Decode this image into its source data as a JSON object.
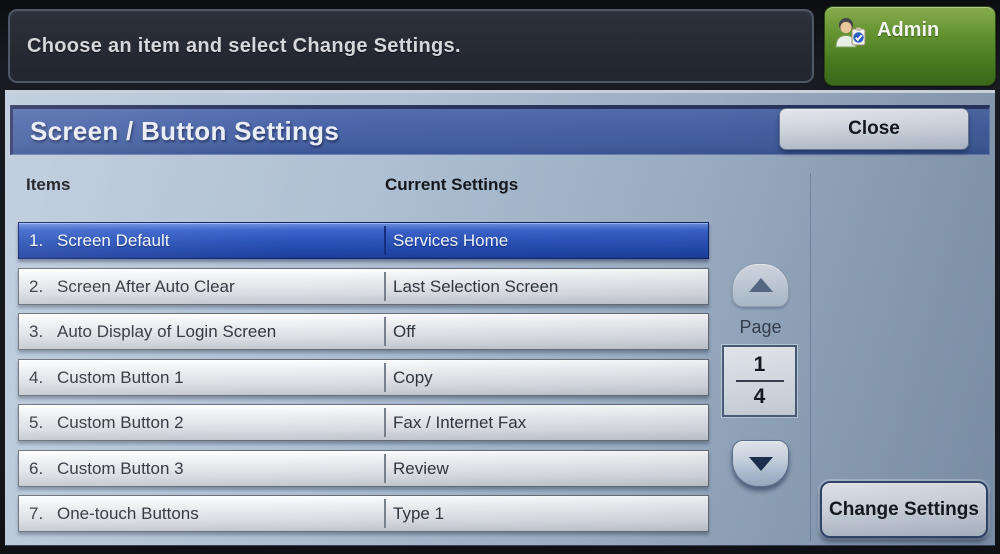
{
  "status_bar": {
    "message": "Choose an item and select Change Settings.",
    "admin_label": "Admin"
  },
  "panel": {
    "title": "Screen / Button Settings",
    "close_label": "Close",
    "columns": {
      "items": "Items",
      "current": "Current Settings"
    },
    "rows": [
      {
        "num": "1.",
        "label": "Screen Default",
        "value": "Services Home",
        "selected": true
      },
      {
        "num": "2.",
        "label": "Screen After Auto Clear",
        "value": "Last Selection Screen",
        "selected": false
      },
      {
        "num": "3.",
        "label": "Auto Display of Login Screen",
        "value": "Off",
        "selected": false
      },
      {
        "num": "4.",
        "label": "Custom Button 1",
        "value": "Copy",
        "selected": false
      },
      {
        "num": "5.",
        "label": "Custom Button 2",
        "value": "Fax / Internet Fax",
        "selected": false
      },
      {
        "num": "6.",
        "label": "Custom Button 3",
        "value": "Review",
        "selected": false
      },
      {
        "num": "7.",
        "label": "One-touch Buttons",
        "value": "Type 1",
        "selected": false
      }
    ],
    "pagination": {
      "label": "Page",
      "current": "1",
      "total": "4"
    },
    "change_settings_label": "Change Settings"
  },
  "icons": {
    "admin": "admin-user-badge-icon",
    "page_up": "page-up-arrow-icon",
    "page_down": "page-down-arrow-icon"
  },
  "colors": {
    "selected_row_blue": "#2952b7",
    "title_bar_blue": "#4a64a8",
    "admin_green": "#61902f",
    "screen_bg": "#afc1d3",
    "status_bar_bg": "#262a33"
  }
}
